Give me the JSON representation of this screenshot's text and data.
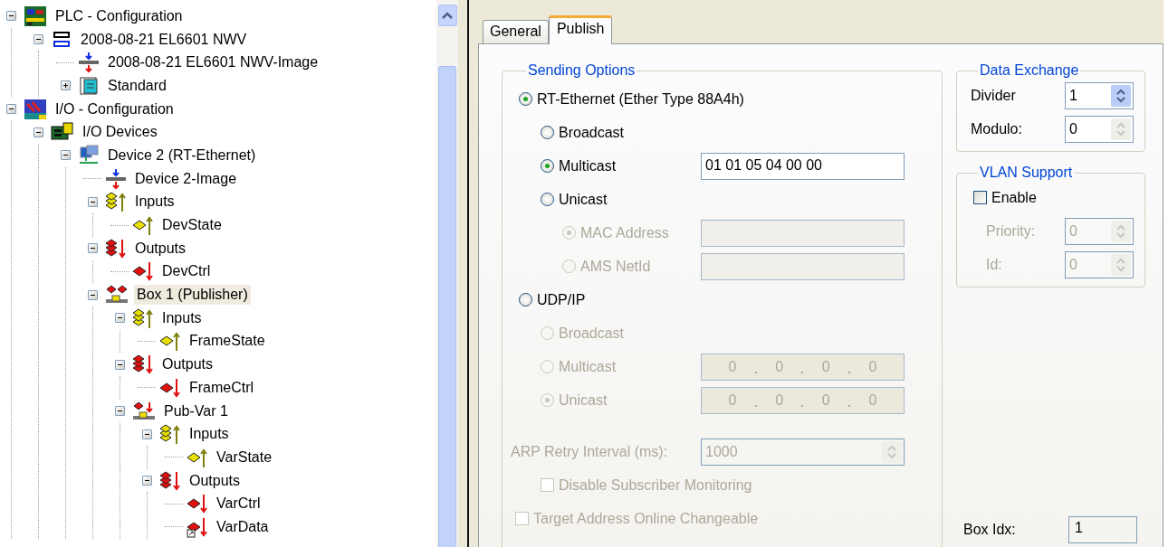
{
  "tree": [
    {
      "label": "PLC - Configuration",
      "kind": "plc",
      "expanded": true,
      "selected": false,
      "children": [
        {
          "label": "2008-08-21 EL6601 NWV",
          "kind": "iec",
          "expanded": true,
          "selected": false,
          "children": [
            {
              "label": "2008-08-21 EL6601 NWV-Image",
              "kind": "image",
              "selected": false
            },
            {
              "label": "Standard",
              "kind": "standard",
              "expanded": false,
              "selected": false
            }
          ]
        }
      ]
    },
    {
      "label": "I/O - Configuration",
      "kind": "io",
      "expanded": true,
      "selected": false,
      "children": [
        {
          "label": "I/O Devices",
          "kind": "iodevices",
          "expanded": true,
          "selected": false,
          "children": [
            {
              "label": "Device 2 (RT-Ethernet)",
              "kind": "device",
              "expanded": true,
              "selected": false,
              "children": [
                {
                  "label": "Device 2-Image",
                  "kind": "image",
                  "selected": false
                },
                {
                  "label": "Inputs",
                  "kind": "inputs",
                  "expanded": true,
                  "selected": false,
                  "children": [
                    {
                      "label": "DevState",
                      "kind": "input-var",
                      "selected": false
                    }
                  ]
                },
                {
                  "label": "Outputs",
                  "kind": "outputs",
                  "expanded": true,
                  "selected": false,
                  "children": [
                    {
                      "label": "DevCtrl",
                      "kind": "output-var",
                      "selected": false
                    }
                  ]
                },
                {
                  "label": "Box 1 (Publisher)",
                  "kind": "box",
                  "expanded": true,
                  "selected": true,
                  "children": [
                    {
                      "label": "Inputs",
                      "kind": "inputs",
                      "expanded": true,
                      "selected": false,
                      "children": [
                        {
                          "label": "FrameState",
                          "kind": "input-var",
                          "selected": false
                        }
                      ]
                    },
                    {
                      "label": "Outputs",
                      "kind": "outputs",
                      "expanded": true,
                      "selected": false,
                      "children": [
                        {
                          "label": "FrameCtrl",
                          "kind": "output-var",
                          "selected": false
                        }
                      ]
                    },
                    {
                      "label": "Pub-Var 1",
                      "kind": "pubvar",
                      "expanded": true,
                      "selected": false,
                      "children": [
                        {
                          "label": "Inputs",
                          "kind": "inputs",
                          "expanded": true,
                          "selected": false,
                          "children": [
                            {
                              "label": "VarState",
                              "kind": "input-var",
                              "selected": false
                            }
                          ]
                        },
                        {
                          "label": "Outputs",
                          "kind": "outputs",
                          "expanded": true,
                          "selected": false,
                          "children": [
                            {
                              "label": "VarCtrl",
                              "kind": "output-var",
                              "selected": false
                            },
                            {
                              "label": "VarData",
                              "kind": "output-link",
                              "selected": false
                            }
                          ]
                        }
                      ]
                    }
                  ]
                }
              ]
            }
          ]
        }
      ]
    }
  ],
  "tabs": [
    {
      "label": "General",
      "selected": false
    },
    {
      "label": "Publish",
      "selected": true
    }
  ],
  "sending_options": {
    "title": "Sending Options",
    "options": [
      {
        "label": "RT-Ethernet (Ether Type 88A4h)",
        "selected": true,
        "disabled": false,
        "children": [
          {
            "label": "Broadcast",
            "selected": false,
            "disabled": false
          },
          {
            "label": "Multicast",
            "selected": true,
            "disabled": false,
            "field": {
              "kind": "text",
              "value": "01 01 05 04 00 00",
              "disabled": false
            }
          },
          {
            "label": "Unicast",
            "selected": false,
            "disabled": false,
            "children": [
              {
                "label": "MAC Address",
                "selected": true,
                "disabled": true,
                "field": {
                  "kind": "text",
                  "disabled": true
                }
              },
              {
                "label": "AMS NetId",
                "selected": false,
                "disabled": true,
                "field": {
                  "kind": "text",
                  "disabled": true
                }
              }
            ]
          }
        ]
      },
      {
        "label": "UDP/IP",
        "selected": false,
        "disabled": false,
        "children": [
          {
            "label": "Broadcast",
            "selected": false,
            "disabled": true
          },
          {
            "label": "Multicast",
            "selected": false,
            "disabled": true,
            "field": {
              "kind": "ip",
              "octets": [
                "0",
                "0",
                "0",
                "0"
              ],
              "disabled": true
            }
          },
          {
            "label": "Unicast",
            "selected": true,
            "disabled": true,
            "field": {
              "kind": "ip",
              "octets": [
                "0",
                "0",
                "0",
                "0"
              ],
              "disabled": true
            }
          }
        ]
      }
    ],
    "arp_retry": {
      "label": "ARP Retry Interval (ms):",
      "value": "1000",
      "disabled": true
    },
    "disable_monitoring": {
      "label": "Disable Subscriber Monitoring",
      "checked": false,
      "disabled": true
    },
    "target_online": {
      "label": "Target Address Online Changeable",
      "checked": false,
      "disabled": true
    }
  },
  "data_exchange": {
    "title": "Data Exchange",
    "fields": [
      {
        "label": "Divider",
        "value": "1",
        "disabled": false,
        "highlighted": true
      },
      {
        "label": "Modulo:",
        "value": "0",
        "disabled": false,
        "highlighted": false
      }
    ]
  },
  "vlan": {
    "title": "VLAN Support",
    "enable": {
      "label": "Enable",
      "checked": false,
      "disabled": false
    },
    "fields": [
      {
        "label": "Priority:",
        "value": "0",
        "disabled": true,
        "highlighted": false
      },
      {
        "label": "Id:",
        "value": "0",
        "disabled": true,
        "highlighted": false
      }
    ]
  },
  "box_idx": {
    "label": "Box Idx:",
    "value": "1"
  }
}
